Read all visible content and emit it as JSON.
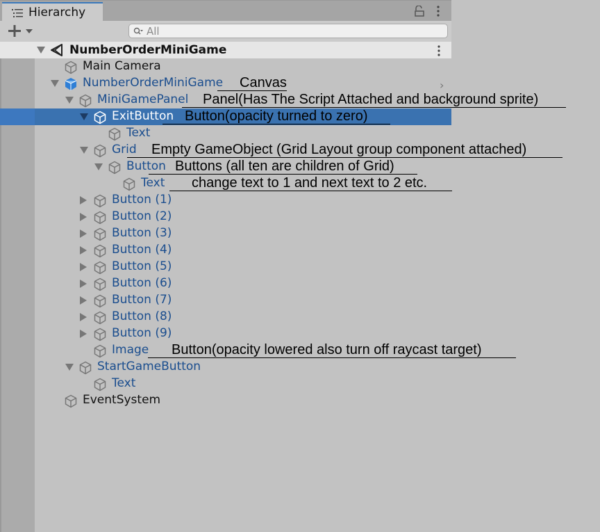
{
  "window": {
    "tab_label": "Hierarchy",
    "tab_icon": "list-icon",
    "lock_icon": "lock-icon",
    "menu_icon": "kebab-menu-icon"
  },
  "toolbar": {
    "add_label": "+",
    "search_placeholder": "All",
    "search_value": ""
  },
  "scene": {
    "name": "NumberOrderMiniGame",
    "icon": "unity-logo-icon",
    "menu_icon": "kebab-menu-icon"
  },
  "tree": [
    {
      "label": "Main Camera",
      "style": "normal",
      "expand": "none",
      "icon": "gameobject-cube-icon"
    },
    {
      "label": "NumberOrderMiniGame",
      "style": "blue",
      "expand": "down",
      "icon": "prefab-cube-icon",
      "chevron": true
    },
    {
      "label": "MiniGamePanel",
      "style": "blue",
      "expand": "down",
      "icon": "gameobject-cube-icon"
    },
    {
      "label": "ExitButton",
      "style": "blue",
      "expand": "down",
      "icon": "gameobject-cube-icon",
      "selected": true
    },
    {
      "label": "Text",
      "style": "blue",
      "expand": "none",
      "icon": "gameobject-cube-icon"
    },
    {
      "label": "Grid",
      "style": "blue",
      "expand": "down",
      "icon": "gameobject-cube-icon"
    },
    {
      "label": "Button",
      "style": "blue",
      "expand": "down",
      "icon": "gameobject-cube-icon"
    },
    {
      "label": "Text",
      "style": "blue",
      "expand": "none",
      "icon": "gameobject-cube-icon"
    },
    {
      "label": "Button (1)",
      "style": "blue",
      "expand": "right",
      "icon": "gameobject-cube-icon"
    },
    {
      "label": "Button (2)",
      "style": "blue",
      "expand": "right",
      "icon": "gameobject-cube-icon"
    },
    {
      "label": "Button (3)",
      "style": "blue",
      "expand": "right",
      "icon": "gameobject-cube-icon"
    },
    {
      "label": "Button (4)",
      "style": "blue",
      "expand": "right",
      "icon": "gameobject-cube-icon"
    },
    {
      "label": "Button (5)",
      "style": "blue",
      "expand": "right",
      "icon": "gameobject-cube-icon"
    },
    {
      "label": "Button (6)",
      "style": "blue",
      "expand": "right",
      "icon": "gameobject-cube-icon"
    },
    {
      "label": "Button (7)",
      "style": "blue",
      "expand": "right",
      "icon": "gameobject-cube-icon"
    },
    {
      "label": "Button (8)",
      "style": "blue",
      "expand": "right",
      "icon": "gameobject-cube-icon"
    },
    {
      "label": "Button (9)",
      "style": "blue",
      "expand": "right",
      "icon": "gameobject-cube-icon"
    },
    {
      "label": "Image",
      "style": "blue",
      "expand": "none",
      "icon": "gameobject-cube-icon"
    },
    {
      "label": "StartGameButton",
      "style": "blue",
      "expand": "down",
      "icon": "gameobject-cube-icon"
    },
    {
      "label": "Text",
      "style": "blue",
      "expand": "none",
      "icon": "gameobject-cube-icon"
    },
    {
      "label": "EventSystem",
      "style": "normal",
      "expand": "none",
      "icon": "gameobject-cube-icon"
    }
  ],
  "annotations": [
    {
      "row": 1,
      "text": "Canvas"
    },
    {
      "row": 2,
      "text": "Panel(Has The Script Attached and background sprite)"
    },
    {
      "row": 3,
      "text": "Button(opacity turned to zero)"
    },
    {
      "row": 5,
      "text": "Empty GameObject (Grid Layout group component attached)"
    },
    {
      "row": 6,
      "text": "Buttons (all ten are children of Grid)"
    },
    {
      "row": 7,
      "text": "change text to 1 and next text to 2 etc."
    },
    {
      "row": 17,
      "text": "Button(opacity lowered also turn off raycast target)"
    }
  ],
  "colors": {
    "selection": "#3a72b0",
    "prefab_text": "#1a4d8e",
    "tab_accent": "#3a79bb"
  }
}
